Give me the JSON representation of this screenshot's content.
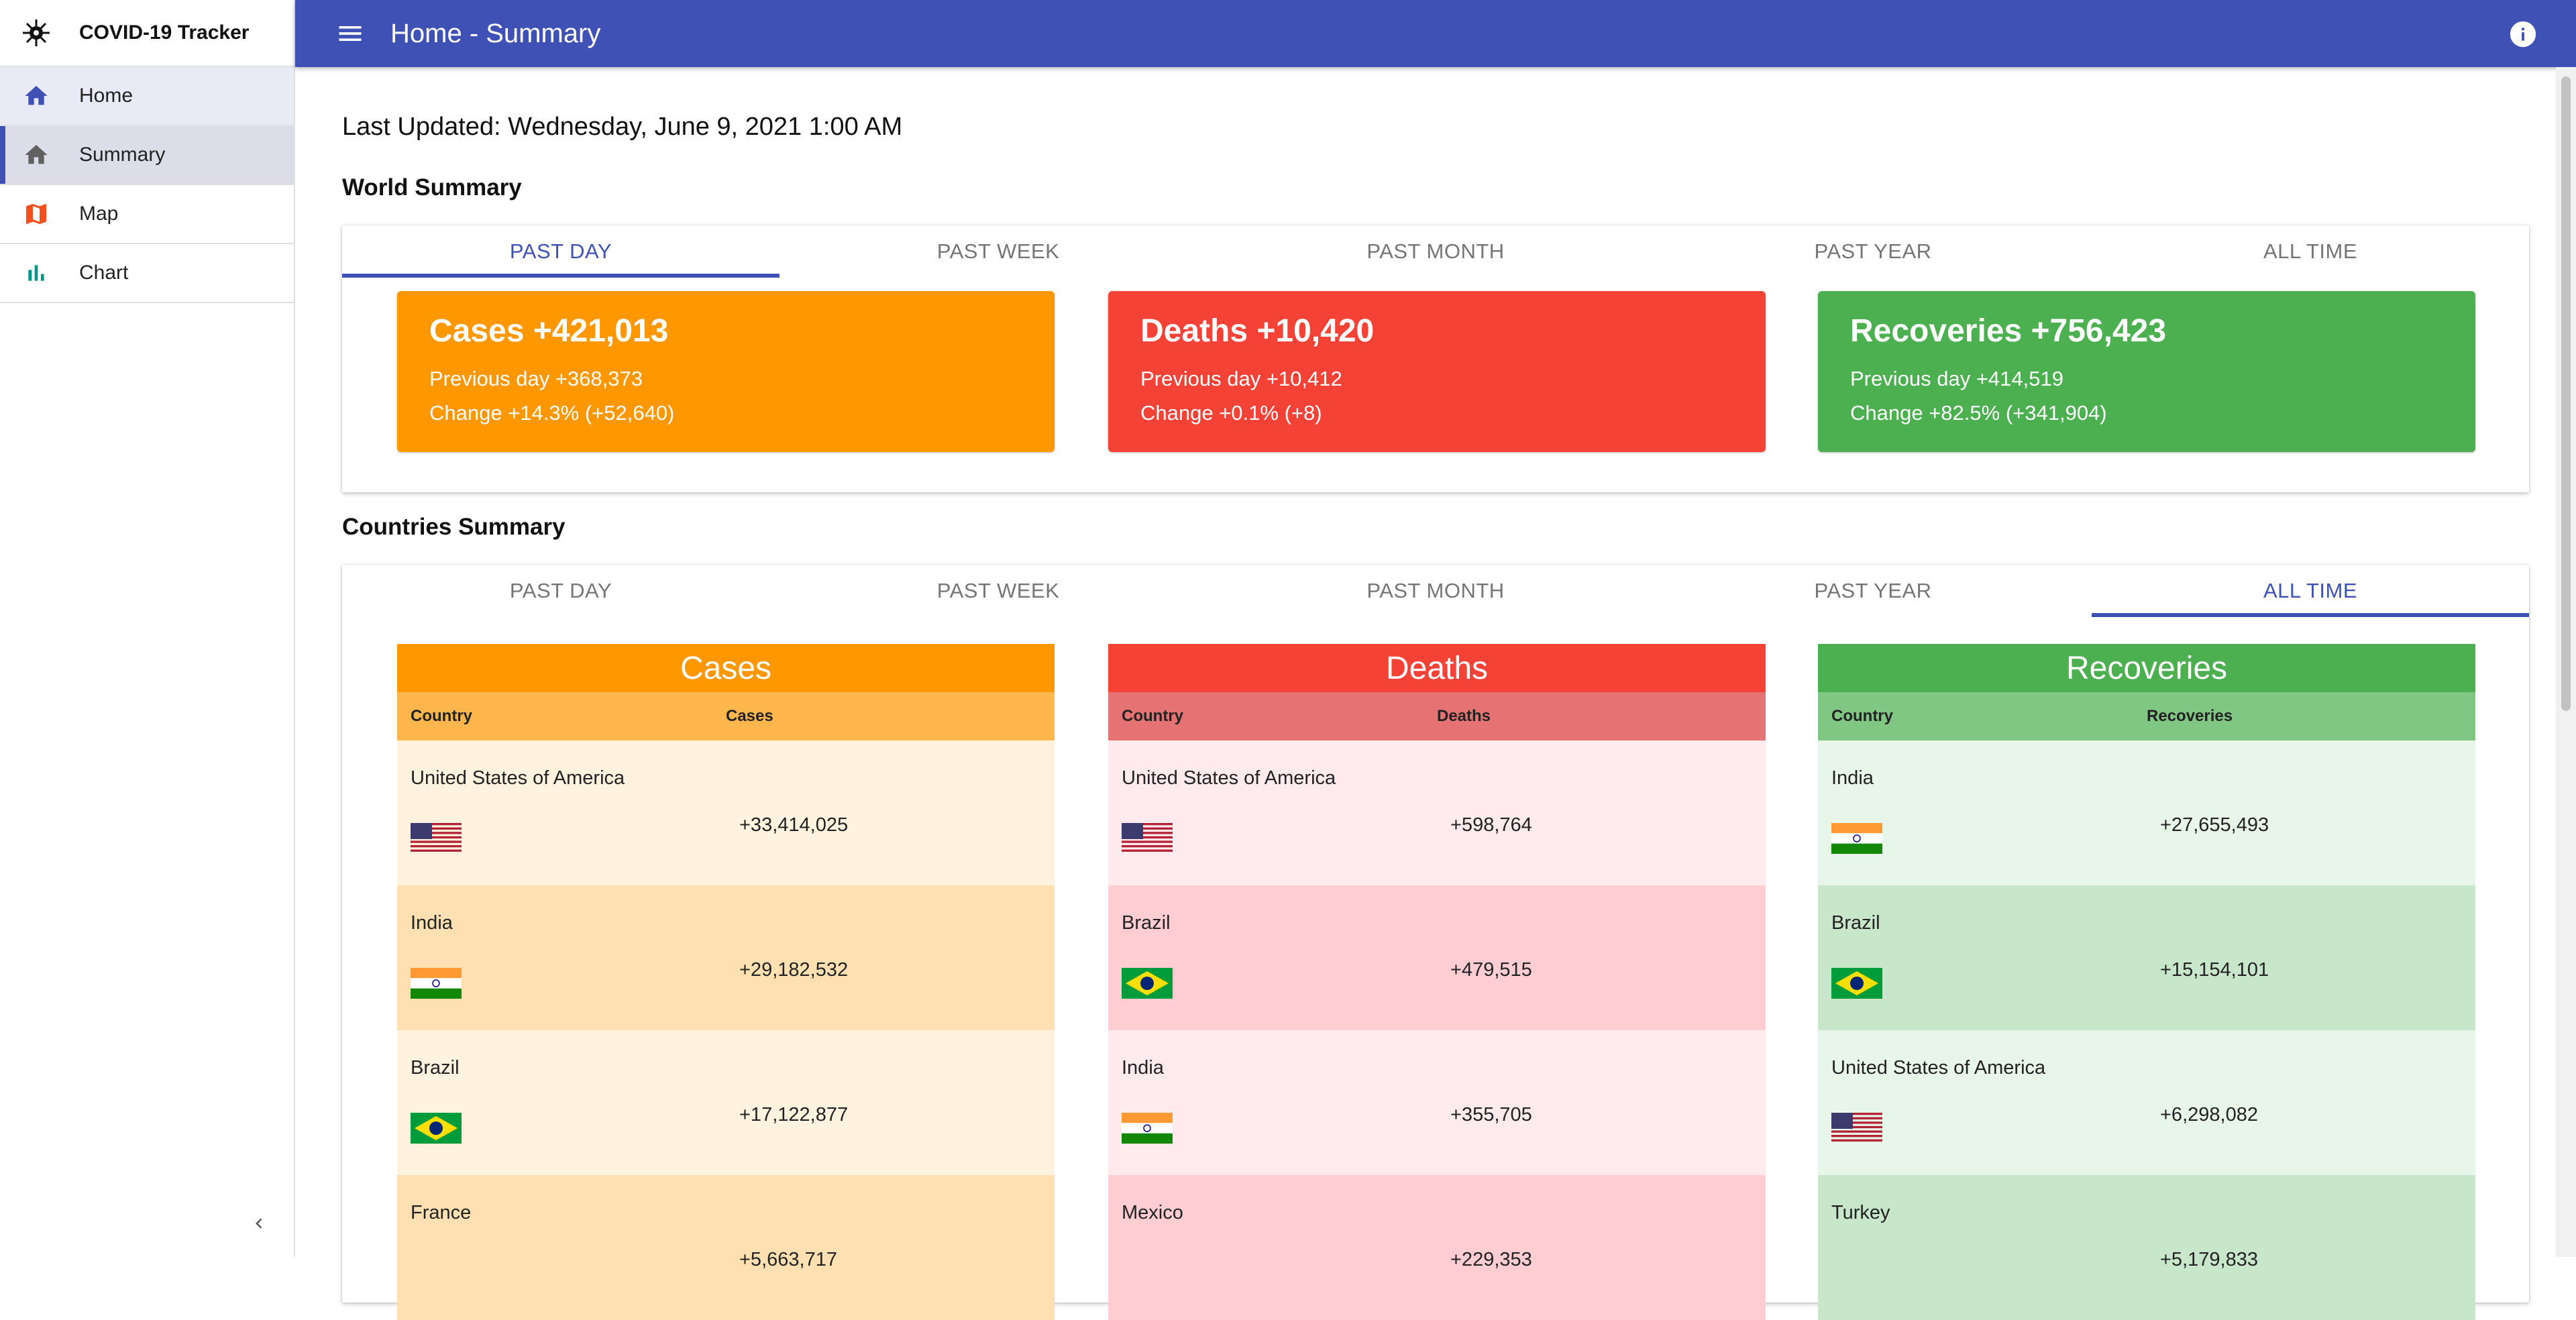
{
  "app": {
    "title": "COVID-19 Tracker"
  },
  "sidebar": {
    "items": [
      {
        "label": "Home",
        "icon": "home-icon"
      },
      {
        "label": "Summary",
        "icon": "home-icon"
      },
      {
        "label": "Map",
        "icon": "map-icon"
      },
      {
        "label": "Chart",
        "icon": "bar-chart-icon"
      }
    ],
    "collapse_icon": "chevron-left-icon"
  },
  "header": {
    "title": "Home - Summary",
    "menu_icon": "menu-icon",
    "info_icon": "info-icon"
  },
  "colors": {
    "primary": "#3f51b5",
    "cases": "#ff9800",
    "deaths": "#f44336",
    "recoveries": "#4caf50"
  },
  "main": {
    "last_updated": "Last Updated: Wednesday, June 9, 2021 1:00 AM",
    "world": {
      "title": "World Summary",
      "tabs": [
        "PAST DAY",
        "PAST WEEK",
        "PAST MONTH",
        "PAST YEAR",
        "ALL TIME"
      ],
      "selected_tab": "PAST DAY",
      "cards": {
        "cases": {
          "heading": "Cases +421,013",
          "previous": "Previous day +368,373",
          "change": "Change +14.3% (+52,640)"
        },
        "deaths": {
          "heading": "Deaths +10,420",
          "previous": "Previous day +10,412",
          "change": "Change +0.1% (+8)"
        },
        "recoveries": {
          "heading": "Recoveries +756,423",
          "previous": "Previous day +414,519",
          "change": "Change +82.5% (+341,904)"
        }
      }
    },
    "countries": {
      "title": "Countries Summary",
      "tabs": [
        "PAST DAY",
        "PAST WEEK",
        "PAST MONTH",
        "PAST YEAR",
        "ALL TIME"
      ],
      "selected_tab": "ALL TIME",
      "cases": {
        "title": "Cases",
        "col_country": "Country",
        "col_value": "Cases",
        "rows": [
          {
            "country": "United States of America",
            "value": "+33,414,025",
            "flag": "us-flag"
          },
          {
            "country": "India",
            "value": "+29,182,532",
            "flag": "india-flag"
          },
          {
            "country": "Brazil",
            "value": "+17,122,877",
            "flag": "brazil-flag"
          },
          {
            "country": "France",
            "value": "+5,663,717",
            "flag": "france-flag"
          }
        ]
      },
      "deaths": {
        "title": "Deaths",
        "col_country": "Country",
        "col_value": "Deaths",
        "rows": [
          {
            "country": "United States of America",
            "value": "+598,764",
            "flag": "us-flag"
          },
          {
            "country": "Brazil",
            "value": "+479,515",
            "flag": "brazil-flag"
          },
          {
            "country": "India",
            "value": "+355,705",
            "flag": "india-flag"
          },
          {
            "country": "Mexico",
            "value": "+229,353",
            "flag": "mexico-flag"
          }
        ]
      },
      "recoveries": {
        "title": "Recoveries",
        "col_country": "Country",
        "col_value": "Recoveries",
        "rows": [
          {
            "country": "India",
            "value": "+27,655,493",
            "flag": "india-flag"
          },
          {
            "country": "Brazil",
            "value": "+15,154,101",
            "flag": "brazil-flag"
          },
          {
            "country": "United States of America",
            "value": "+6,298,082",
            "flag": "us-flag"
          },
          {
            "country": "Turkey",
            "value": "+5,179,833",
            "flag": "turkey-flag"
          }
        ]
      }
    }
  }
}
